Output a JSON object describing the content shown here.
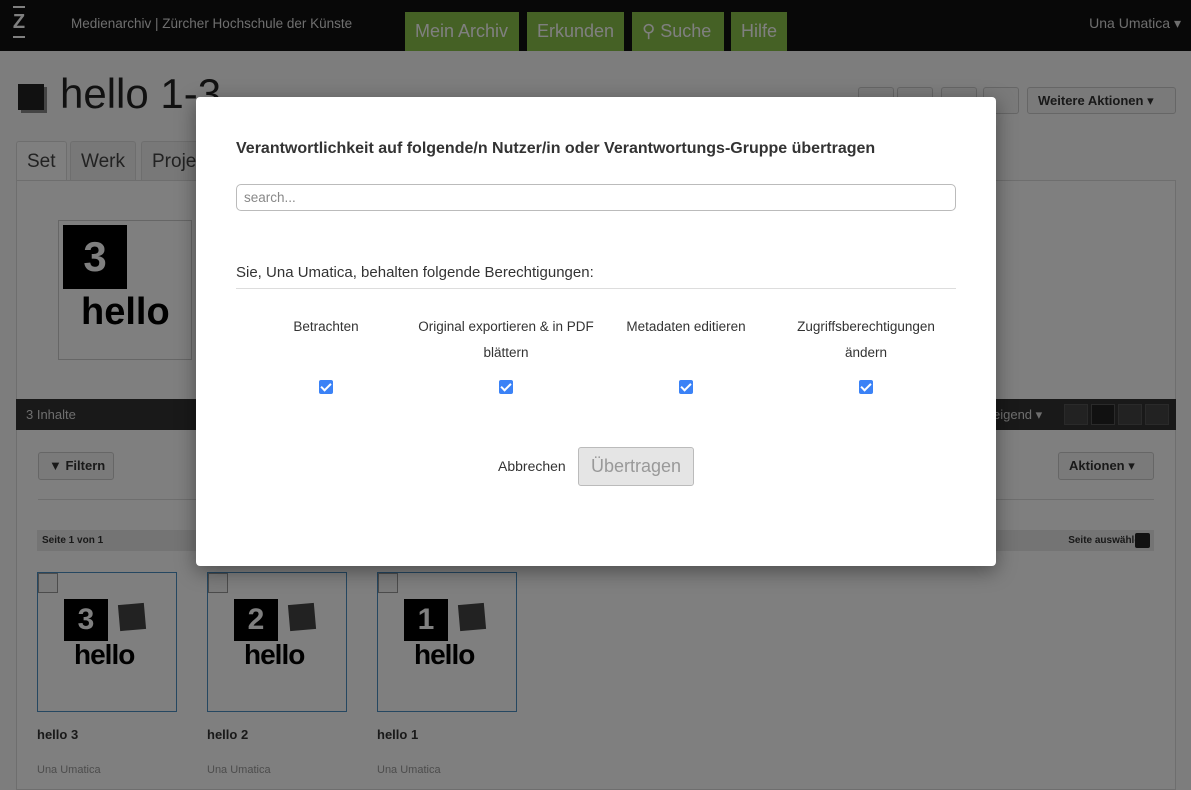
{
  "header": {
    "site_title": "Medienarchiv | Zürcher Hochschule der Künste",
    "nav": [
      "Mein Archiv",
      "Erkunden",
      "Suche",
      "Hilfe"
    ],
    "user": "Una Umatica ▾"
  },
  "page": {
    "title": "hello 1-3",
    "more_actions": "Weitere Aktionen",
    "tabs": [
      "Set",
      "Werk",
      "Proje"
    ]
  },
  "content_bar": {
    "count": "3 Inhalte",
    "sort": "eigend ▾"
  },
  "listing": {
    "filter": "Filtern",
    "actions": "Aktionen",
    "page_label": "Seite 1 von 1",
    "select_page": "Seite auswählen",
    "items": [
      {
        "num": "3",
        "title": "hello 3",
        "owner": "Una Umatica"
      },
      {
        "num": "2",
        "title": "hello 2",
        "owner": "Una Umatica"
      },
      {
        "num": "1",
        "title": "hello 1",
        "owner": "Una Umatica"
      }
    ],
    "cover_num": "3",
    "hello_text": "hello"
  },
  "modal": {
    "title": "Verantwortlichkeit auf folgende/n Nutzer/in oder Verantwortungs-Gruppe übertragen",
    "search_placeholder": "search...",
    "perm_heading": "Sie, Una Umatica, behalten folgende Berechtigungen:",
    "permissions": [
      {
        "label": "Betrachten",
        "checked": true
      },
      {
        "label": "Original exportieren & in PDF blättern",
        "checked": true
      },
      {
        "label": "Metadaten editieren",
        "checked": true
      },
      {
        "label": "Zugriffsberechtigungen ändern",
        "checked": true
      }
    ],
    "cancel": "Abbrechen",
    "submit": "Übertragen"
  }
}
